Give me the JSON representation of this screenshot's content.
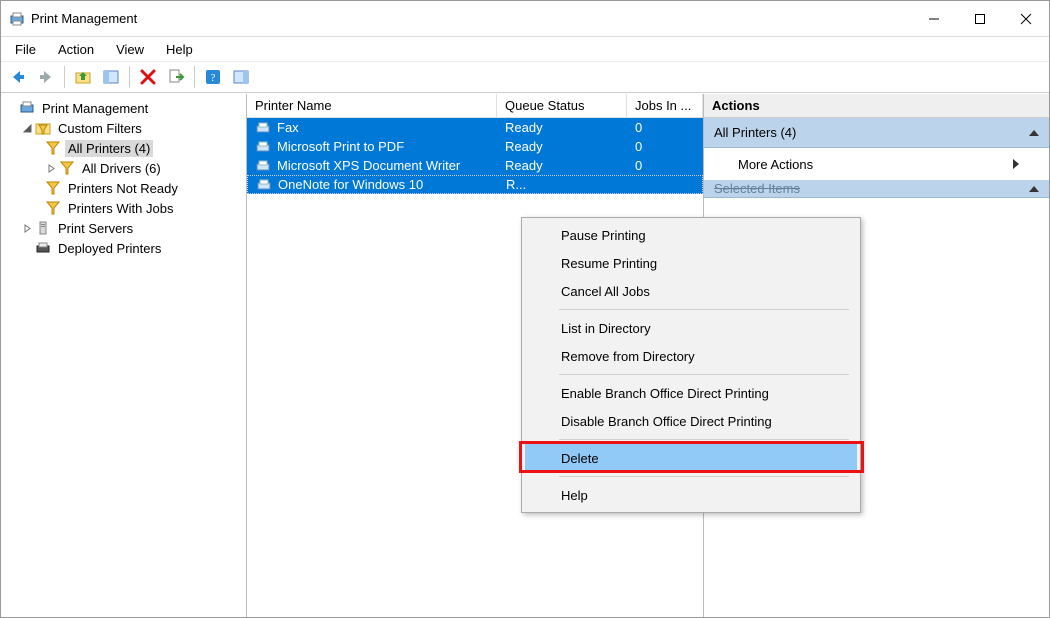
{
  "window": {
    "title": "Print Management"
  },
  "menu": {
    "file": "File",
    "action": "Action",
    "view": "View",
    "help": "Help"
  },
  "tree": {
    "root": "Print Management",
    "custom_filters": "Custom Filters",
    "all_printers": "All Printers (4)",
    "all_drivers": "All Drivers (6)",
    "printers_not_ready": "Printers Not Ready",
    "printers_with_jobs": "Printers With Jobs",
    "print_servers": "Print Servers",
    "deployed_printers": "Deployed Printers"
  },
  "list": {
    "columns": {
      "name": "Printer Name",
      "status": "Queue Status",
      "jobs": "Jobs In ..."
    },
    "rows": [
      {
        "name": "Fax",
        "status": "Ready",
        "jobs": "0"
      },
      {
        "name": "Microsoft Print to PDF",
        "status": "Ready",
        "jobs": "0"
      },
      {
        "name": "Microsoft XPS Document Writer",
        "status": "Ready",
        "jobs": "0"
      },
      {
        "name": "OneNote for Windows 10",
        "status": "R...",
        "jobs": ""
      }
    ]
  },
  "actions": {
    "header": "Actions",
    "group1": "All Printers (4)",
    "more_actions": "More Actions",
    "group2_partial": "Selected Items"
  },
  "context_menu": {
    "pause": "Pause Printing",
    "resume": "Resume Printing",
    "cancel_all": "Cancel All Jobs",
    "list_dir": "List in Directory",
    "remove_dir": "Remove from Directory",
    "enable_branch": "Enable Branch Office Direct Printing",
    "disable_branch": "Disable Branch Office Direct Printing",
    "delete": "Delete",
    "help": "Help"
  }
}
